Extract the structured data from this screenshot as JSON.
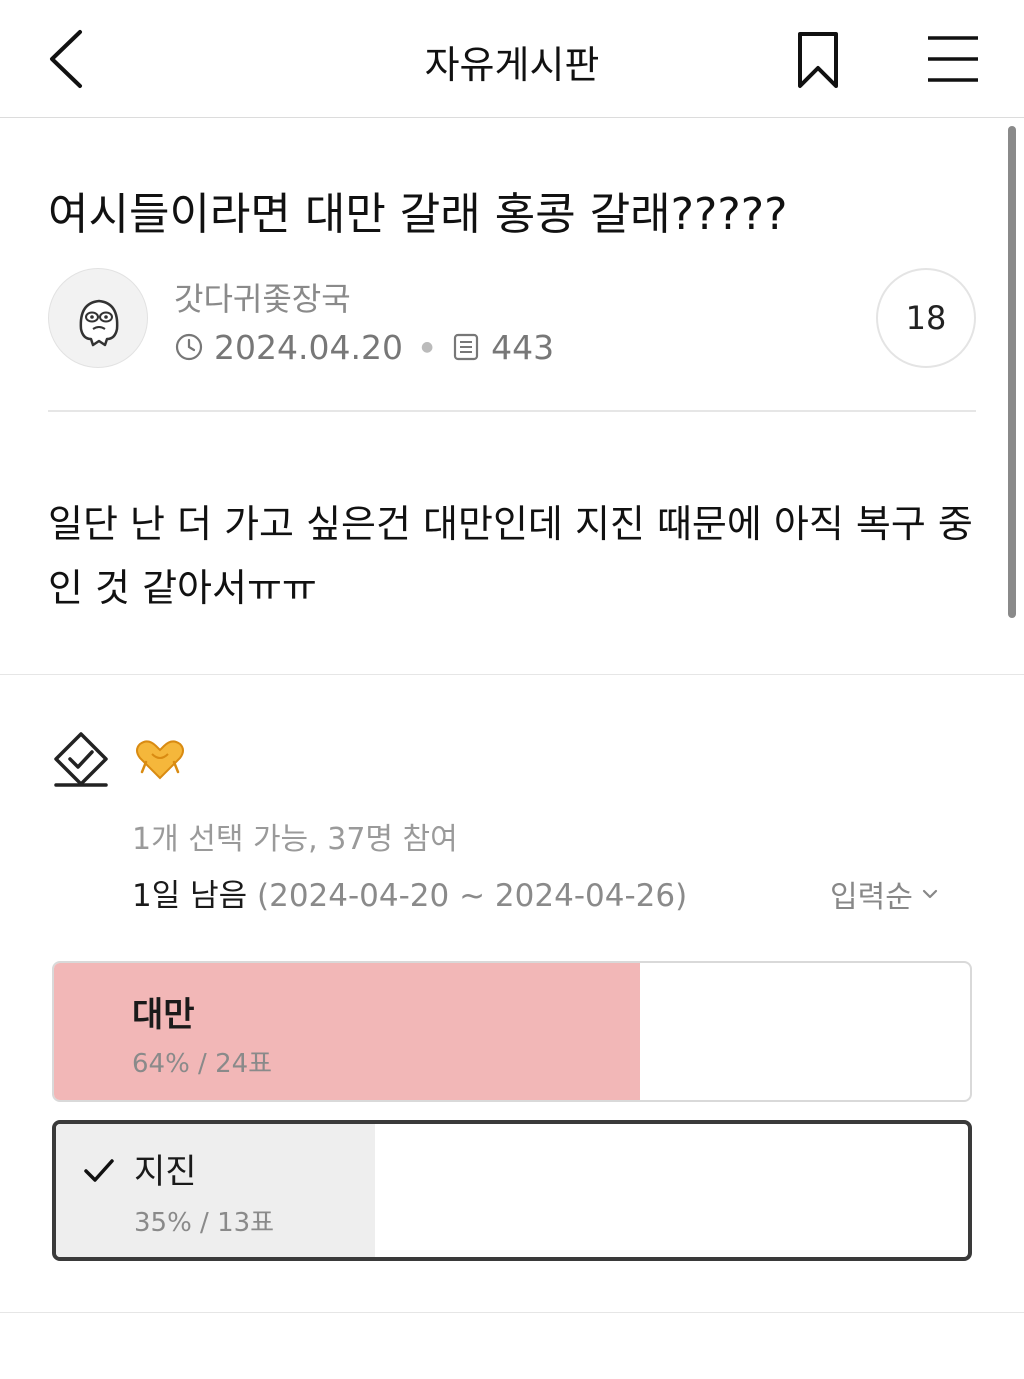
{
  "header": {
    "title": "자유게시판"
  },
  "post": {
    "title": "여시들이라면 대만 갈래 홍콩 갈래?????",
    "author": "갓다귀좇장국",
    "date": "2024.04.20",
    "views": "443",
    "comment_count": "18",
    "body": "일단 난 더 가고 싶은건 대만인데 지진 때문에 아직 복구 중인 것 같아서ㅠㅠ"
  },
  "poll": {
    "info": "1개 선택 가능, 37명 참여",
    "remaining": "1일 남음",
    "period": "(2024-04-20 ~ 2024-04-26)",
    "sort_label": "입력순",
    "options": [
      {
        "label": "대만",
        "stats": "64% / 24표",
        "percent": 64,
        "selected": false
      },
      {
        "label": "지진",
        "stats": "35% / 13표",
        "percent": 35,
        "selected": true
      }
    ]
  },
  "colors": {
    "option_1_fill": "#f2b7b7",
    "option_2_fill": "#eeeeee",
    "selected_border": "#3a3a3a"
  },
  "icons": [
    "back-arrow-icon",
    "bookmark-icon",
    "menu-icon",
    "clock-icon",
    "document-icon",
    "vote-check-icon",
    "heart-hands-icon",
    "chevron-down-icon",
    "checkmark-icon"
  ]
}
